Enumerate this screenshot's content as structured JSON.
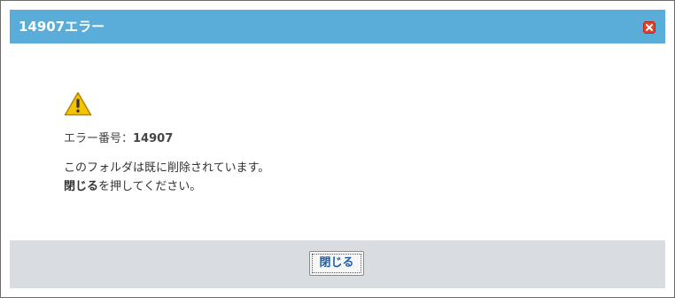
{
  "dialog": {
    "title": "14907エラー",
    "close_icon": "close-x-icon",
    "warning_icon": "warning-triangle-icon",
    "error_label": "エラー番号：",
    "error_number": "14907",
    "message": "このフォルダは既に削除されています。",
    "instruction_bold": "閉じる",
    "instruction_rest": "を押してください。",
    "close_button_label": "閉じる"
  },
  "colors": {
    "titlebar": "#5aacd9",
    "footer": "#d9dde2",
    "close_icon": "#e0412b",
    "warning": "#f5c400",
    "button_text": "#1f5fa8"
  }
}
